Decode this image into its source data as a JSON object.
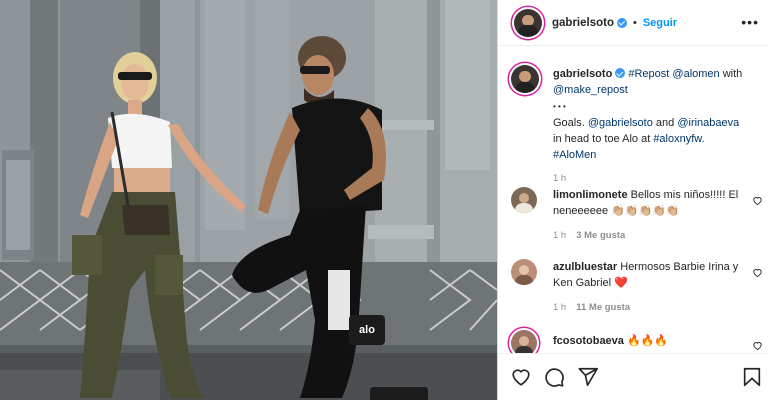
{
  "post": {
    "username": "gabrielsoto",
    "separator": "•",
    "follow_label": "Seguir",
    "more_label": "•••",
    "photo_tag": "alo"
  },
  "caption": {
    "username": "gabrielsoto",
    "repost": "#Repost",
    "alomen": "@alomen",
    "with": "with",
    "make_repost": "@make_repost",
    "dots": "• • •",
    "goals": "Goals.",
    "mention1": "@gabrielsoto",
    "and": "and",
    "mention2": "@irinabaeva",
    "in_text": "in head to toe Alo at",
    "tag1": "#aloxnyfw.",
    "tag2": "#AloMen",
    "time": "1 h"
  },
  "comments": [
    {
      "username": "limonlimonete",
      "text": "Bellos mis niños!!!!! El neneeeeee 👏🏼👏🏼👏🏼👏🏼👏🏼",
      "time": "1 h",
      "likes": "3 Me gusta",
      "avatar_color": "#7a6a55"
    },
    {
      "username": "azulbluestar",
      "text": "Hermosos Barbie Irina y Ken Gabriel ❤️",
      "time": "1 h",
      "likes": "11 Me gusta",
      "avatar_color": "#b98f78"
    },
    {
      "username": "fcosotobaeva",
      "text": "🔥🔥🔥",
      "time": "",
      "likes": "",
      "avatar_color": "#9b7466"
    }
  ],
  "icons": [
    "verified-badge-icon",
    "heart-icon",
    "comment-icon",
    "share-icon",
    "bookmark-icon",
    "more-options-icon"
  ],
  "colors": {
    "link": "#00376b",
    "follow": "#0095f6",
    "verified": "#3897f0",
    "meta": "#8e8e8e"
  }
}
